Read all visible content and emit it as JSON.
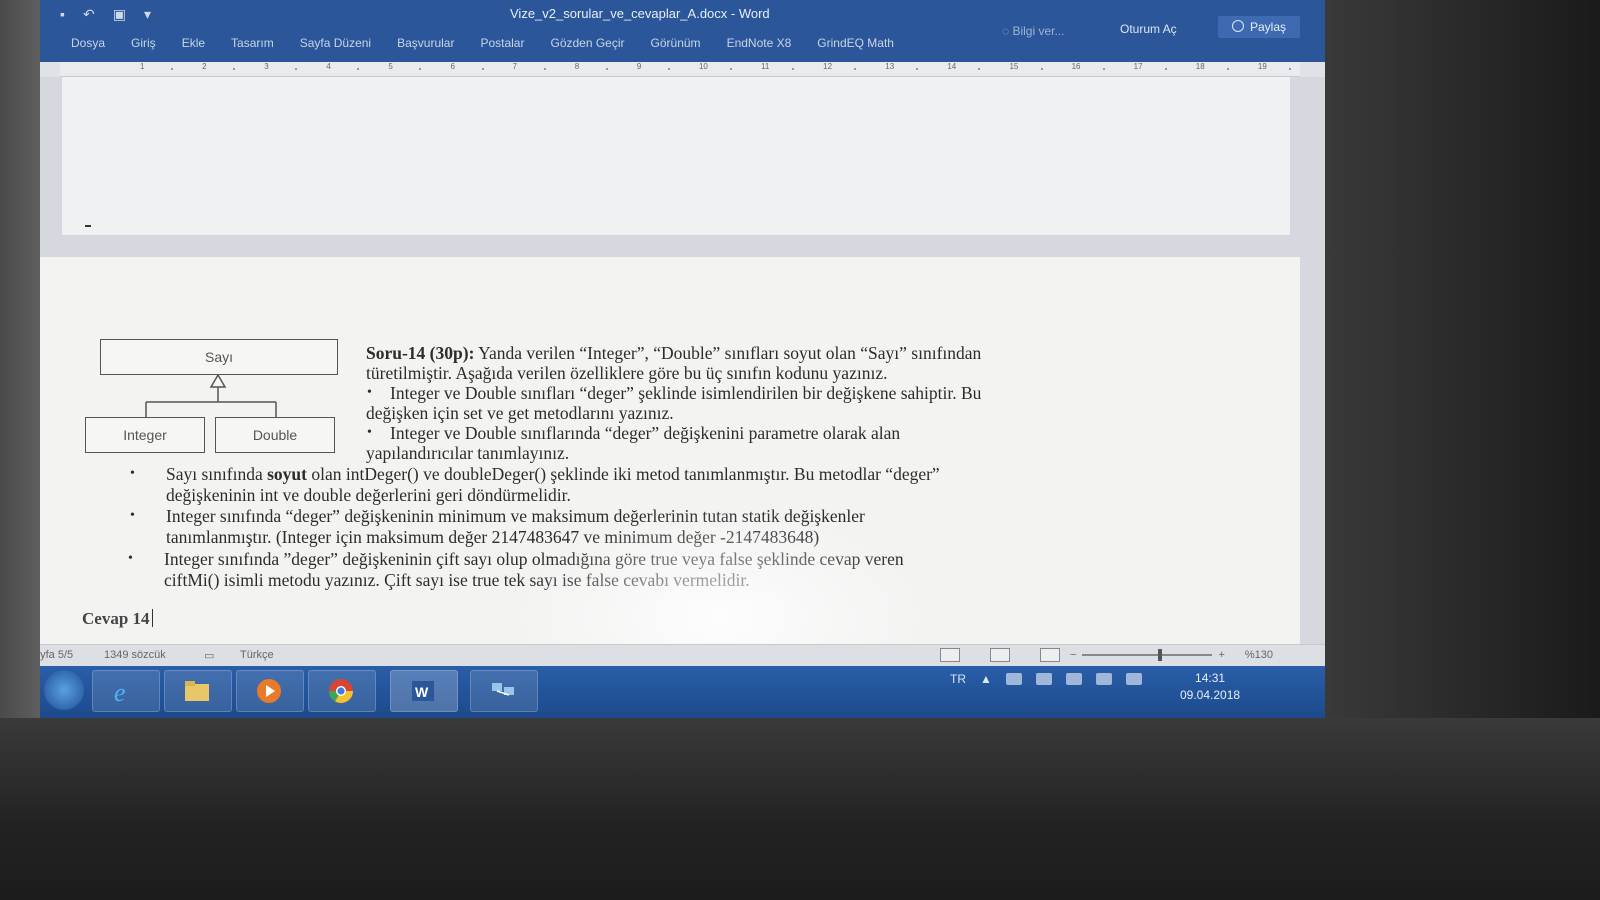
{
  "window": {
    "title": "Vize_v2_sorular_ve_cevaplar_A.docx - Word",
    "tell_me": "Bilgi ver...",
    "sign_in": "Oturum Aç",
    "share": "Paylaş"
  },
  "ribbon": {
    "tabs": [
      "Dosya",
      "Giriş",
      "Ekle",
      "Tasarım",
      "Sayfa Düzeni",
      "Başvurular",
      "Postalar",
      "Gözden Geçir",
      "Görünüm",
      "EndNote X8",
      "GrindEQ Math"
    ]
  },
  "ruler": {
    "numbers": [
      "1",
      "2",
      "3",
      "4",
      "5",
      "6",
      "7",
      "8",
      "9",
      "10",
      "11",
      "12",
      "13",
      "14",
      "15",
      "16",
      "17",
      "18",
      "19"
    ]
  },
  "diagram": {
    "parent": "Sayı",
    "child_left": "Integer",
    "child_right": "Double"
  },
  "question": {
    "label": "Soru-14 (30p):",
    "intro_1": "Yanda verilen “Integer”, “Double” sınıfları soyut olan “Sayı” sınıfından",
    "intro_2": "türetilmiştir. Aşağıda verilen özelliklere göre bu üç sınıfın kodunu yazınız.",
    "b1_1": "Integer ve Double sınıfları “deger” şeklinde isimlendirilen bir değişkene sahiptir. Bu",
    "b1_2": "değişken için set ve get metodlarını yazınız.",
    "b2_1": "Integer ve Double sınıflarında “deger” değişkenini parametre olarak alan",
    "b2_2": "yapılandırıcılar tanımlayınız.",
    "b3_pre": "Sayı sınıfında",
    "b3_bold": "soyut",
    "b3_post": "olan intDeger() ve doubleDeger() şeklinde iki metod tanımlanmıştır. Bu metodlar “deger”",
    "b3_2": "değişkeninin int ve double değerlerini geri döndürmelidir.",
    "b4_1": "Integer sınıfında “deger” değişkeninin minimum ve maksimum değerlerinin tutan statik değişkenler",
    "b4_2": "tanımlanmıştır. (Integer için maksimum değer 2147483647 ve minimum değer -2147483648)",
    "b5_1": "Integer sınıfında ”deger” değişkeninin çift sayı olup olmadığına göre true veya false şeklinde cevap veren",
    "b5_2": "ciftMi() isimli metodu yazınız. Çift sayı ise true tek sayı ise false cevabı vermelidir.",
    "answer": "Cevap 14"
  },
  "status": {
    "page": "ayfa 5/5",
    "words": "1349 sözcük",
    "language": "Türkçe",
    "zoom": "%130",
    "zoom_minus": "−",
    "zoom_plus": "+",
    "zoom_level_fraction": 0.58
  },
  "taskbar": {
    "lang": "TR",
    "tray_arrow": "▲",
    "time": "14:31",
    "date": "09.04.2018",
    "items": [
      "internet-explorer",
      "file-explorer",
      "media-player",
      "chrome",
      "word",
      "network-app"
    ]
  },
  "colors": {
    "word_blue": "#2b579a",
    "taskbar_blue": "#1c4a8c"
  }
}
